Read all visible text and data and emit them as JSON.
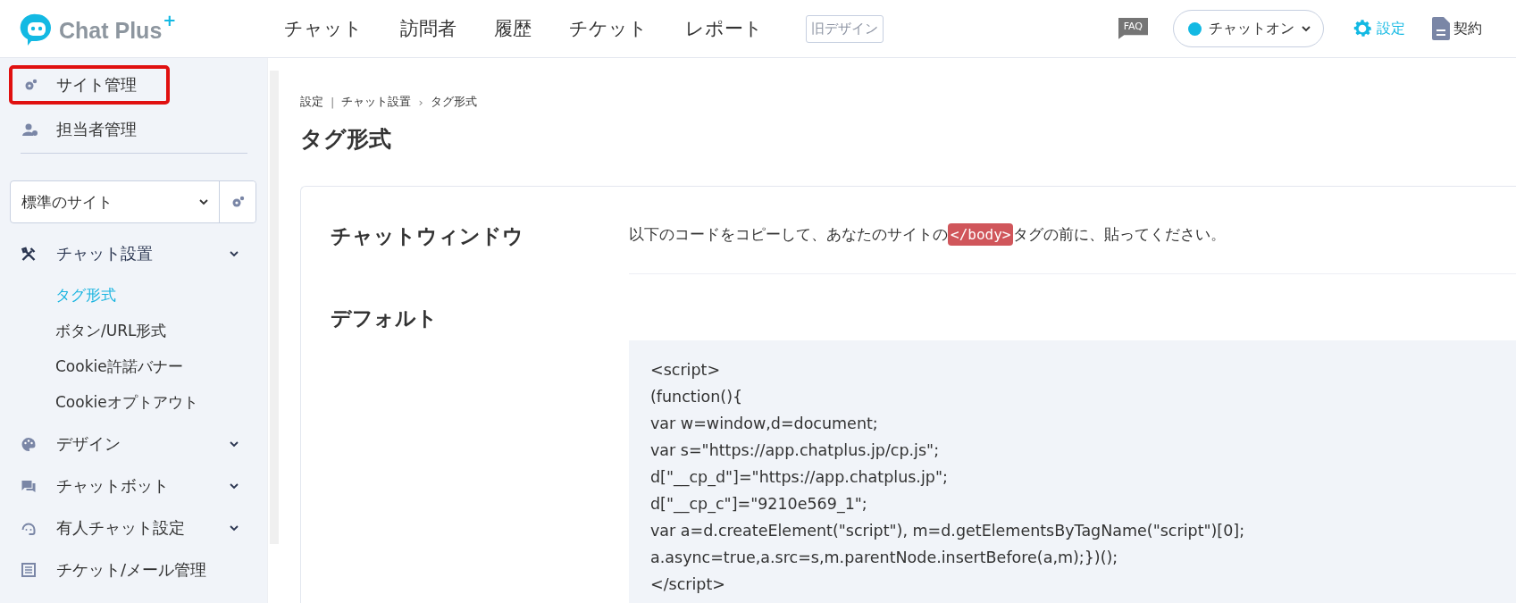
{
  "header": {
    "logo": {
      "name": "Chat Plus",
      "sup": "+"
    },
    "nav": [
      {
        "label": "チャット"
      },
      {
        "label": "訪問者"
      },
      {
        "label": "履歴"
      },
      {
        "label": "チケット"
      },
      {
        "label": "レポート"
      }
    ],
    "old_design_button": "旧デザイン",
    "faq_label": "FAQ",
    "status_dropdown": {
      "label": "チャットオン",
      "on": true
    },
    "settings_link": "設定",
    "contract_link": "契約"
  },
  "sidebar": {
    "top_items": [
      {
        "label": "サイト管理",
        "highlighted": true
      },
      {
        "label": "担当者管理",
        "highlighted": false
      }
    ],
    "site_select": {
      "value": "標準のサイト"
    },
    "menu": [
      {
        "label": "チャット設置",
        "kind": "group",
        "children": [
          {
            "label": "タグ形式",
            "selected": true
          },
          {
            "label": "ボタン/URL形式",
            "selected": false
          },
          {
            "label": "Cookie許諾バナー",
            "selected": false
          },
          {
            "label": "Cookieオプトアウト",
            "selected": false
          }
        ]
      },
      {
        "label": "デザイン",
        "kind": "group"
      },
      {
        "label": "チャットボット",
        "kind": "group"
      },
      {
        "label": "有人チャット設定",
        "kind": "group"
      },
      {
        "label": "チケット/メール管理",
        "kind": "link"
      }
    ]
  },
  "breadcrumb": [
    {
      "label": "設定",
      "separator": "|"
    },
    {
      "label": "チャット設置",
      "separator": "›"
    },
    {
      "label": "タグ形式"
    }
  ],
  "page_title": "タグ形式",
  "sections": [
    {
      "heading": "チャットウィンドウ",
      "instruction": {
        "before": "以下のコードをコピーして、あなたのサイトの",
        "tag": "</body>",
        "after": "タグの前に、貼ってください。"
      }
    },
    {
      "heading": "デフォルト",
      "code_lines": [
        "<script>",
        "(function(){",
        "var w=window,d=document;",
        "var s=\"https://app.chatplus.jp/cp.js\";",
        "d[\"__cp_d\"]=\"https://app.chatplus.jp\";",
        "d[\"__cp_c\"]=\"9210e569_1\";",
        "var a=d.createElement(\"script\"), m=d.getElementsByTagName(\"script\")[0];",
        "a.async=true,a.src=s,m.parentNode.insertBefore(a,m);})();",
        "</script>"
      ]
    }
  ]
}
